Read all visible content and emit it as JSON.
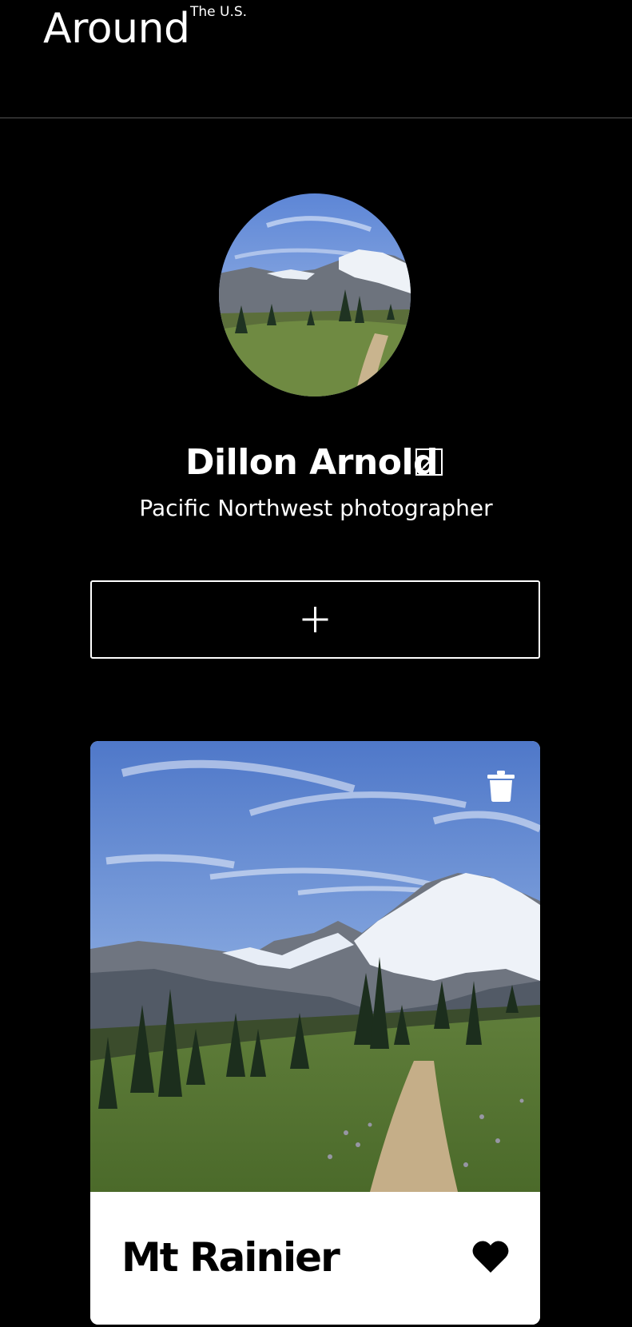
{
  "header": {
    "logo": "Around",
    "logo_sub": "The U.S."
  },
  "profile": {
    "name": "Dillon Arnold",
    "about": "Pacific Northwest photographer",
    "avatar_icon": "mountain-landscape-photo"
  },
  "toolbar": {
    "add_icon": "plus-icon",
    "edit_icon": "pencil-icon"
  },
  "cards": [
    {
      "title": "Mt Rainier",
      "image_icon": "mountain-landscape-photo",
      "delete_icon": "trash-icon",
      "like_icon": "heart-icon"
    }
  ],
  "colors": {
    "background": "#000000",
    "text": "#ffffff",
    "card_bg": "#ffffff",
    "card_text": "#000000"
  }
}
